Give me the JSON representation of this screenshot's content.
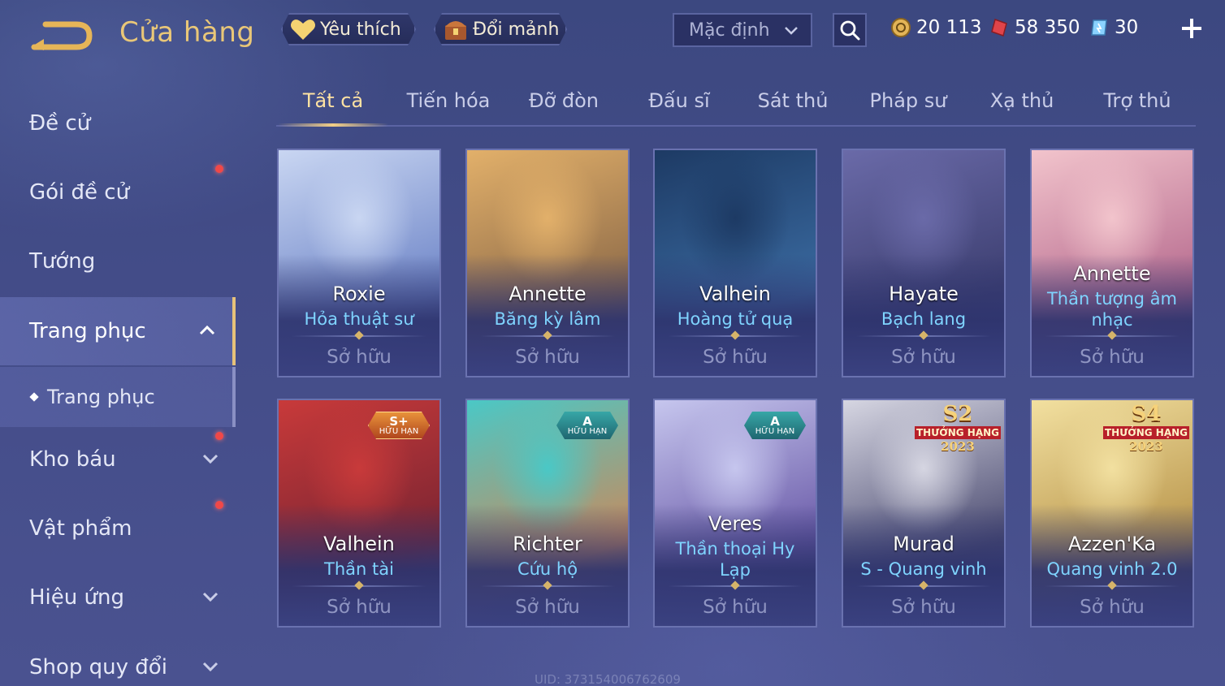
{
  "header": {
    "title": "Cửa hàng",
    "favorites_label": "Yêu thích",
    "exchange_label": "Đổi mảnh",
    "sort_selected": "Mặc định",
    "currencies": [
      {
        "icon": "gold-coin-icon",
        "value": "20 113"
      },
      {
        "icon": "red-gem-icon",
        "value": "58 350"
      },
      {
        "icon": "voucher-icon",
        "value": "30"
      }
    ]
  },
  "sidebar": {
    "items": [
      {
        "label": "Đề cử"
      },
      {
        "label": "Gói đề cử"
      },
      {
        "label": "Tướng"
      },
      {
        "label": "Trang phục"
      },
      {
        "label": "Trang phục"
      },
      {
        "label": "Kho báu"
      },
      {
        "label": "Vật phẩm"
      },
      {
        "label": "Hiệu ứng"
      },
      {
        "label": "Shop quy đổi"
      }
    ]
  },
  "tabs": [
    {
      "label": "Tất cả"
    },
    {
      "label": "Tiến hóa"
    },
    {
      "label": "Đỡ đòn"
    },
    {
      "label": "Đấu sĩ"
    },
    {
      "label": "Sát thủ"
    },
    {
      "label": "Pháp sư"
    },
    {
      "label": "Xạ thủ"
    },
    {
      "label": "Trợ thủ"
    }
  ],
  "cards": [
    {
      "hero": "Roxie",
      "skin": "Hỏa thuật sư",
      "status": "Sở hữu",
      "color1": "#c9d6f2",
      "color2": "#6f86c8"
    },
    {
      "hero": "Annette",
      "skin": "Băng kỳ lâm",
      "status": "Sở hữu",
      "color1": "#e2b06a",
      "color2": "#8d6a48"
    },
    {
      "hero": "Valhein",
      "skin": "Hoàng tử quạ",
      "status": "Sở hữu",
      "color1": "#1d3a64",
      "color2": "#3a6aa0"
    },
    {
      "hero": "Hayate",
      "skin": "Bạch lang",
      "status": "Sở hữu",
      "color1": "#6a6aa8",
      "color2": "#3c3e70"
    },
    {
      "hero": "Annette",
      "skin": "Thần tượng âm nhạc",
      "status": "Sở hữu",
      "color1": "#f2c4cc",
      "color2": "#b66a8e"
    },
    {
      "hero": "Valhein",
      "skin": "Thần tài",
      "status": "Sở hữu",
      "color1": "#c83a3a",
      "color2": "#7a2432",
      "badge": {
        "type": "spl",
        "grade": "S+",
        "limited": "HỮU HẠN"
      }
    },
    {
      "hero": "Richter",
      "skin": "Cứu hộ",
      "status": "Sở hữu",
      "color1": "#4ac8c6",
      "color2": "#c98a5c",
      "badge": {
        "type": "a",
        "grade": "A",
        "limited": "HỮU HẠN"
      }
    },
    {
      "hero": "Veres",
      "skin": "Thần thoại Hy Lạp",
      "status": "Sở hữu",
      "color1": "#c6c6ee",
      "color2": "#6a5aa8",
      "badge": {
        "type": "a",
        "grade": "A",
        "limited": "HỮU HẠN"
      }
    },
    {
      "hero": "Murad",
      "skin": "S - Quang vinh",
      "status": "Sở hữu",
      "color1": "#d6d6e2",
      "color2": "#4a4a70",
      "rank": {
        "season": "S2",
        "label": "THƯỞNG HẠNG",
        "year": "2023"
      }
    },
    {
      "hero": "Azzen'Ka",
      "skin": "Quang vinh 2.0",
      "status": "Sở hữu",
      "color1": "#f2e0a0",
      "color2": "#b8944a",
      "rank": {
        "season": "S4",
        "label": "THƯỞNG HẠNG",
        "year": "2023"
      }
    }
  ],
  "footer": {
    "uid": "UID: 373154006762609"
  }
}
